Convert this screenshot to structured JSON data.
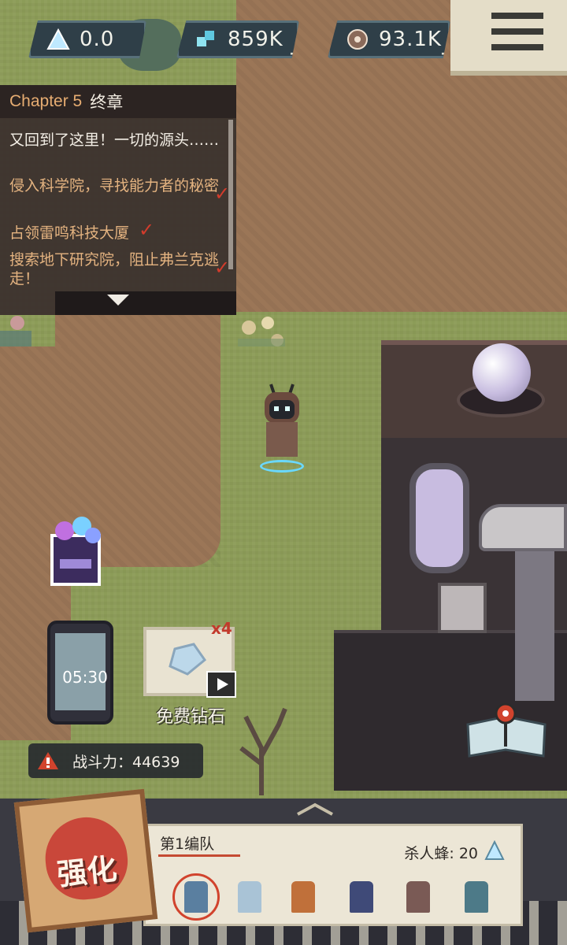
{
  "resources": [
    {
      "name": "triangle-crystal",
      "value": "0.0"
    },
    {
      "name": "gems",
      "value": "859K"
    },
    {
      "name": "gear-parts",
      "value": "93.1K"
    }
  ],
  "quest": {
    "chapter_label": "Chapter 5",
    "chapter_name": "终章",
    "intro": "又回到了这里！一切的源头……",
    "tasks": [
      {
        "text": "侵入科学院，寻找能力者的秘密",
        "done": true
      },
      {
        "text": "占领雷鸣科技大厦",
        "done": true
      },
      {
        "text": "搜索地下研究院，阻止弗兰克逃走！",
        "done": true
      }
    ]
  },
  "phone": {
    "time": "05:30"
  },
  "free_diamonds": {
    "multiplier": "x4",
    "label": "免费钻石"
  },
  "power": {
    "label": "战斗力：44639"
  },
  "team": {
    "name": "第1编队",
    "kill_label": "杀人蜂: 20",
    "heroes": [
      {
        "color": "#5a7fa0"
      },
      {
        "color": "#a9c3d6"
      },
      {
        "color": "#c0703a"
      },
      {
        "color": "#3f4a78"
      },
      {
        "color": "#7a5a55"
      },
      {
        "color": "#4d7a88"
      }
    ]
  },
  "upgrade": {
    "label": "强化"
  },
  "colors": {
    "accent_red": "#d1432d",
    "panel_bg": "#ece6d6",
    "quest_done": "#e4b380"
  }
}
